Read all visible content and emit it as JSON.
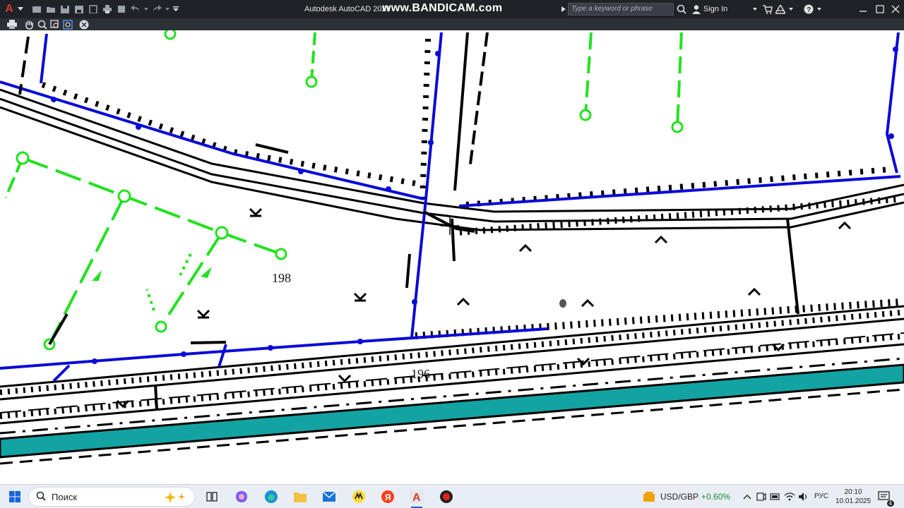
{
  "titlebar": {
    "app_title": "Autodesk AutoCAD 2021",
    "overlay": "www.BANDICAM.com",
    "search_placeholder": "Type a keyword or phrase",
    "signin_label": "Sign In",
    "icons": [
      "autocad-logo-icon",
      "new-file-icon",
      "open-icon",
      "save-icon",
      "save-as-icon",
      "open-web-icon",
      "plot-icon",
      "undo-icon",
      "redo-icon",
      "qat-dropdown-icon",
      "expand-icon",
      "search-icon",
      "user-icon",
      "dropdown-icon",
      "cart-icon",
      "autodesk-a360-icon",
      "help-icon",
      "minimize-icon",
      "maximize-icon",
      "close-icon"
    ]
  },
  "toolstrip": {
    "icons": [
      "print-icon",
      "pan-hand-icon",
      "zoom-icon",
      "zoom-window-icon",
      "zoom-extents-icon",
      "close-viewer-icon"
    ]
  },
  "drawing": {
    "labels": [
      {
        "text": "198"
      },
      {
        "text": "196"
      }
    ],
    "colors": {
      "line_black": "#000000",
      "water_pipe_blue": "#0a0ad8",
      "gas_pipe_green": "#21e21f",
      "ditch_teal": "#13a3a3"
    }
  },
  "taskbar": {
    "search_label": "Поиск",
    "ticker_label": "USD/GBP",
    "ticker_value": "+0.60%",
    "language": "РУС",
    "time": "20:10",
    "date": "10.01.2025",
    "notification_count": "4",
    "apps": [
      "start-icon",
      "search-icon",
      "copilot-icon",
      "task-view-icon",
      "teams-icon",
      "edge-icon",
      "file-explorer-icon",
      "mail-icon",
      "yandex-market-icon",
      "yandex-browser-icon",
      "autocad-icon",
      "bandicam-record-icon"
    ]
  }
}
